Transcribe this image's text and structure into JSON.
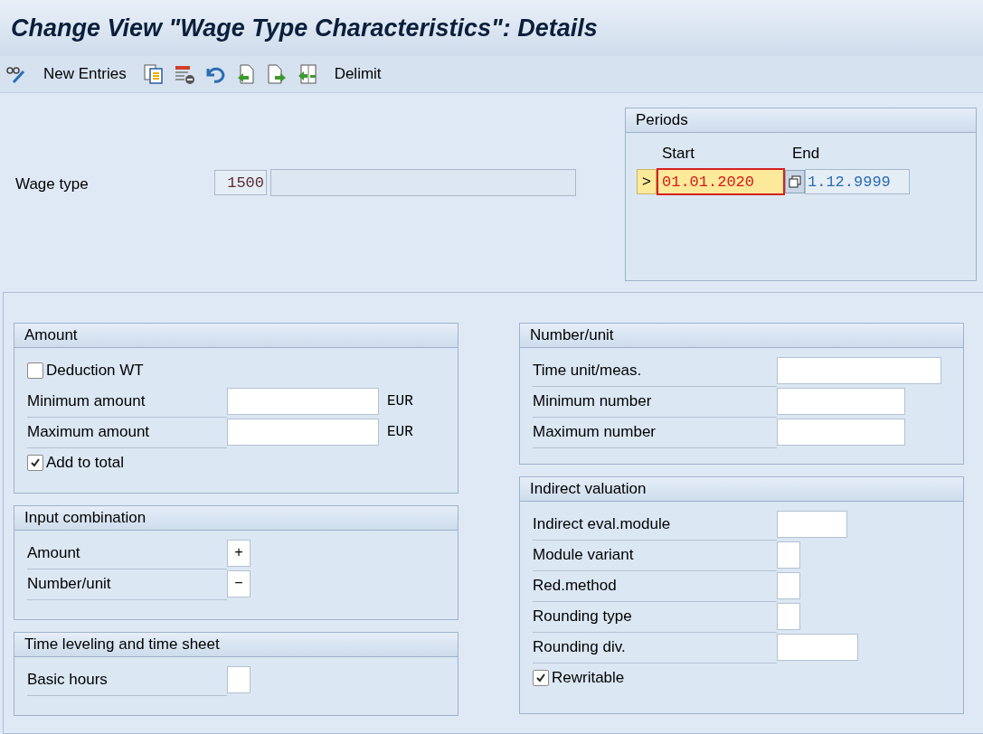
{
  "title": "Change View \"Wage Type Characteristics\": Details",
  "toolbar": [
    {
      "kind": "glasses-pencil"
    },
    {
      "kind": "text",
      "label": "New Entries"
    },
    {
      "kind": "copy"
    },
    {
      "kind": "delete"
    },
    {
      "kind": "undo"
    },
    {
      "kind": "previous"
    },
    {
      "kind": "next"
    },
    {
      "kind": "delimit"
    },
    {
      "kind": "text",
      "label": "Delimit"
    }
  ],
  "wage_type": {
    "label": "Wage type",
    "code": "1500"
  },
  "periods": {
    "title": "Periods",
    "start_label": "Start",
    "end_label": "End",
    "marker": ">",
    "start": "01.01.2020",
    "end": "1.12.9999"
  },
  "left_groups": [
    {
      "title": "Amount",
      "rows": [
        {
          "kind": "checkbox",
          "label": "Deduction WT",
          "checked": false
        },
        {
          "kind": "field",
          "label": "Minimum amount",
          "unit": "EUR"
        },
        {
          "kind": "field",
          "label": "Maximum amount",
          "unit": "EUR"
        },
        {
          "kind": "checkbox",
          "label": "Add to total",
          "checked": true
        }
      ]
    },
    {
      "title": "Input combination",
      "rows": [
        {
          "kind": "char",
          "label": "Amount",
          "value": "+"
        },
        {
          "kind": "char",
          "label": "Number/unit",
          "value": "−"
        }
      ]
    },
    {
      "title": "Time leveling and time sheet",
      "rows": [
        {
          "kind": "char",
          "label": "Basic hours"
        }
      ]
    }
  ],
  "right_groups": [
    {
      "title": "Number/unit",
      "rows": [
        {
          "kind": "wide",
          "label": "Time unit/meas."
        },
        {
          "kind": "field",
          "label": "Minimum number"
        },
        {
          "kind": "field",
          "label": "Maximum number"
        }
      ]
    },
    {
      "title": "Indirect valuation",
      "rows": [
        {
          "kind": "module",
          "label": "Indirect eval.module"
        },
        {
          "kind": "char",
          "label": "Module variant"
        },
        {
          "kind": "char",
          "label": "Red.method"
        },
        {
          "kind": "char",
          "label": "Rounding type"
        },
        {
          "kind": "div",
          "label": "Rounding div."
        },
        {
          "kind": "checkbox",
          "label": "Rewritable",
          "checked": true
        }
      ]
    }
  ]
}
